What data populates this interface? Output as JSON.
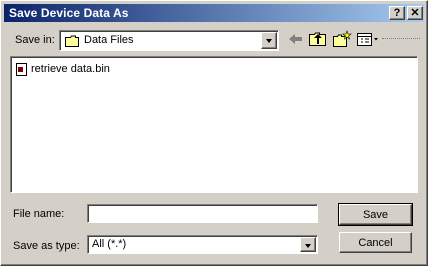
{
  "window": {
    "title": "Save Device Data As"
  },
  "titlebar_buttons": {
    "help": "?",
    "close": "✕"
  },
  "save_in": {
    "label": "Save in:",
    "value": "Data Files"
  },
  "toolbar": {
    "back_icon": "arrow-left-icon",
    "up_icon": "folder-up-icon",
    "new_folder_icon": "new-folder-icon",
    "view_icon": "view-menu-icon"
  },
  "files": [
    {
      "name": "retrieve data.bin",
      "icon": "file-bin-icon"
    }
  ],
  "file_name": {
    "label": "File name:",
    "value": ""
  },
  "save_as_type": {
    "label": "Save as type:",
    "value": "All (*.*)"
  },
  "buttons": {
    "save": "Save",
    "cancel": "Cancel"
  }
}
